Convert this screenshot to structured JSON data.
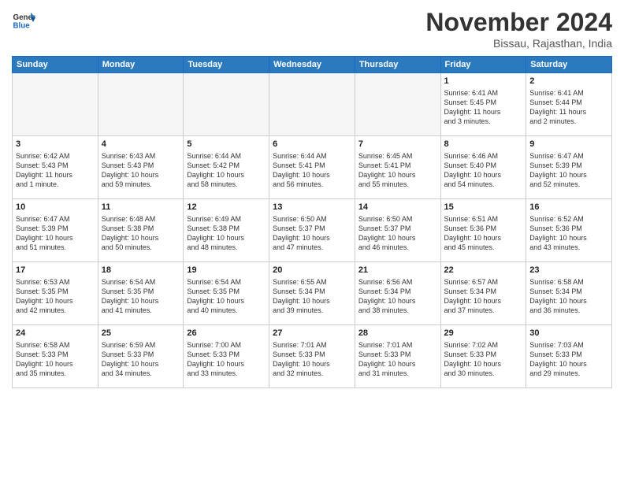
{
  "header": {
    "logo_general": "General",
    "logo_blue": "Blue",
    "month_title": "November 2024",
    "location": "Bissau, Rajasthan, India"
  },
  "weekdays": [
    "Sunday",
    "Monday",
    "Tuesday",
    "Wednesday",
    "Thursday",
    "Friday",
    "Saturday"
  ],
  "weeks": [
    [
      {
        "day": "",
        "info": ""
      },
      {
        "day": "",
        "info": ""
      },
      {
        "day": "",
        "info": ""
      },
      {
        "day": "",
        "info": ""
      },
      {
        "day": "",
        "info": ""
      },
      {
        "day": "1",
        "info": "Sunrise: 6:41 AM\nSunset: 5:45 PM\nDaylight: 11 hours\nand 3 minutes."
      },
      {
        "day": "2",
        "info": "Sunrise: 6:41 AM\nSunset: 5:44 PM\nDaylight: 11 hours\nand 2 minutes."
      }
    ],
    [
      {
        "day": "3",
        "info": "Sunrise: 6:42 AM\nSunset: 5:43 PM\nDaylight: 11 hours\nand 1 minute."
      },
      {
        "day": "4",
        "info": "Sunrise: 6:43 AM\nSunset: 5:43 PM\nDaylight: 10 hours\nand 59 minutes."
      },
      {
        "day": "5",
        "info": "Sunrise: 6:44 AM\nSunset: 5:42 PM\nDaylight: 10 hours\nand 58 minutes."
      },
      {
        "day": "6",
        "info": "Sunrise: 6:44 AM\nSunset: 5:41 PM\nDaylight: 10 hours\nand 56 minutes."
      },
      {
        "day": "7",
        "info": "Sunrise: 6:45 AM\nSunset: 5:41 PM\nDaylight: 10 hours\nand 55 minutes."
      },
      {
        "day": "8",
        "info": "Sunrise: 6:46 AM\nSunset: 5:40 PM\nDaylight: 10 hours\nand 54 minutes."
      },
      {
        "day": "9",
        "info": "Sunrise: 6:47 AM\nSunset: 5:39 PM\nDaylight: 10 hours\nand 52 minutes."
      }
    ],
    [
      {
        "day": "10",
        "info": "Sunrise: 6:47 AM\nSunset: 5:39 PM\nDaylight: 10 hours\nand 51 minutes."
      },
      {
        "day": "11",
        "info": "Sunrise: 6:48 AM\nSunset: 5:38 PM\nDaylight: 10 hours\nand 50 minutes."
      },
      {
        "day": "12",
        "info": "Sunrise: 6:49 AM\nSunset: 5:38 PM\nDaylight: 10 hours\nand 48 minutes."
      },
      {
        "day": "13",
        "info": "Sunrise: 6:50 AM\nSunset: 5:37 PM\nDaylight: 10 hours\nand 47 minutes."
      },
      {
        "day": "14",
        "info": "Sunrise: 6:50 AM\nSunset: 5:37 PM\nDaylight: 10 hours\nand 46 minutes."
      },
      {
        "day": "15",
        "info": "Sunrise: 6:51 AM\nSunset: 5:36 PM\nDaylight: 10 hours\nand 45 minutes."
      },
      {
        "day": "16",
        "info": "Sunrise: 6:52 AM\nSunset: 5:36 PM\nDaylight: 10 hours\nand 43 minutes."
      }
    ],
    [
      {
        "day": "17",
        "info": "Sunrise: 6:53 AM\nSunset: 5:35 PM\nDaylight: 10 hours\nand 42 minutes."
      },
      {
        "day": "18",
        "info": "Sunrise: 6:54 AM\nSunset: 5:35 PM\nDaylight: 10 hours\nand 41 minutes."
      },
      {
        "day": "19",
        "info": "Sunrise: 6:54 AM\nSunset: 5:35 PM\nDaylight: 10 hours\nand 40 minutes."
      },
      {
        "day": "20",
        "info": "Sunrise: 6:55 AM\nSunset: 5:34 PM\nDaylight: 10 hours\nand 39 minutes."
      },
      {
        "day": "21",
        "info": "Sunrise: 6:56 AM\nSunset: 5:34 PM\nDaylight: 10 hours\nand 38 minutes."
      },
      {
        "day": "22",
        "info": "Sunrise: 6:57 AM\nSunset: 5:34 PM\nDaylight: 10 hours\nand 37 minutes."
      },
      {
        "day": "23",
        "info": "Sunrise: 6:58 AM\nSunset: 5:34 PM\nDaylight: 10 hours\nand 36 minutes."
      }
    ],
    [
      {
        "day": "24",
        "info": "Sunrise: 6:58 AM\nSunset: 5:33 PM\nDaylight: 10 hours\nand 35 minutes."
      },
      {
        "day": "25",
        "info": "Sunrise: 6:59 AM\nSunset: 5:33 PM\nDaylight: 10 hours\nand 34 minutes."
      },
      {
        "day": "26",
        "info": "Sunrise: 7:00 AM\nSunset: 5:33 PM\nDaylight: 10 hours\nand 33 minutes."
      },
      {
        "day": "27",
        "info": "Sunrise: 7:01 AM\nSunset: 5:33 PM\nDaylight: 10 hours\nand 32 minutes."
      },
      {
        "day": "28",
        "info": "Sunrise: 7:01 AM\nSunset: 5:33 PM\nDaylight: 10 hours\nand 31 minutes."
      },
      {
        "day": "29",
        "info": "Sunrise: 7:02 AM\nSunset: 5:33 PM\nDaylight: 10 hours\nand 30 minutes."
      },
      {
        "day": "30",
        "info": "Sunrise: 7:03 AM\nSunset: 5:33 PM\nDaylight: 10 hours\nand 29 minutes."
      }
    ]
  ]
}
